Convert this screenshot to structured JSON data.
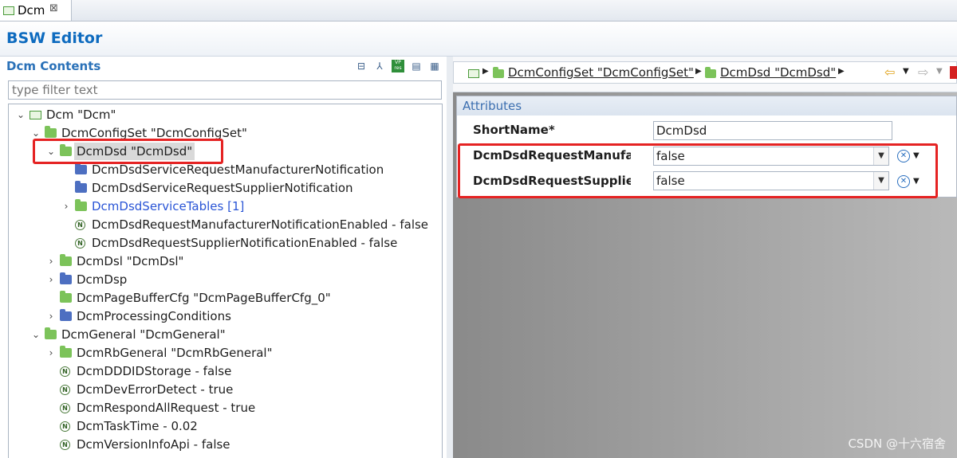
{
  "editor_tab": {
    "label": "Dcm",
    "close": "⊠"
  },
  "header": {
    "title": "BSW Editor"
  },
  "contents": {
    "title": "Dcm Contents",
    "filter_placeholder": "type filter text",
    "toolbar_vp_label": "VP res"
  },
  "tree": [
    {
      "text": "Dcm \"Dcm\"",
      "twisty": "⌄",
      "icon": "module"
    },
    {
      "text": "DcmConfigSet \"DcmConfigSet\"",
      "twisty": "⌄",
      "icon": "folder-green"
    },
    {
      "text": "DcmDsd \"DcmDsd\"",
      "twisty": "⌄",
      "icon": "folder-green",
      "selected": true
    },
    {
      "text": "DcmDsdServiceRequestManufacturerNotification",
      "twisty": "",
      "icon": "folder-blue"
    },
    {
      "text": "DcmDsdServiceRequestSupplierNotification",
      "twisty": "",
      "icon": "folder-blue"
    },
    {
      "text": "DcmDsdServiceTables [1]",
      "twisty": "›",
      "icon": "folder-green",
      "link": true
    },
    {
      "text": "DcmDsdRequestManufacturerNotificationEnabled - false",
      "twisty": "",
      "icon": "param"
    },
    {
      "text": "DcmDsdRequestSupplierNotificationEnabled - false",
      "twisty": "",
      "icon": "param"
    },
    {
      "text": "DcmDsl \"DcmDsl\"",
      "twisty": "›",
      "icon": "folder-green"
    },
    {
      "text": "DcmDsp",
      "twisty": "›",
      "icon": "folder-blue"
    },
    {
      "text": "DcmPageBufferCfg \"DcmPageBufferCfg_0\"",
      "twisty": "",
      "icon": "folder-green"
    },
    {
      "text": "DcmProcessingConditions",
      "twisty": "›",
      "icon": "folder-blue"
    },
    {
      "text": "DcmGeneral \"DcmGeneral\"",
      "twisty": "⌄",
      "icon": "folder-green"
    },
    {
      "text": "DcmRbGeneral \"DcmRbGeneral\"",
      "twisty": "›",
      "icon": "folder-green"
    },
    {
      "text": "DcmDDDIDStorage - false",
      "twisty": "",
      "icon": "param"
    },
    {
      "text": "DcmDevErrorDetect - true",
      "twisty": "",
      "icon": "param"
    },
    {
      "text": "DcmRespondAllRequest - true",
      "twisty": "",
      "icon": "param"
    },
    {
      "text": "DcmTaskTime - 0.02",
      "twisty": "",
      "icon": "param"
    },
    {
      "text": "DcmVersionInfoApi - false",
      "twisty": "",
      "icon": "param"
    }
  ],
  "breadcrumb": {
    "items": [
      "DcmConfigSet \"DcmConfigSet\"",
      "DcmDsd \"DcmDsd\""
    ]
  },
  "attributes": {
    "title": "Attributes",
    "short_name_label": "ShortName*",
    "short_name_value": "DcmDsd",
    "field1_label": "DcmDsdRequestManufact",
    "field1_value": "false",
    "field2_label": "DcmDsdRequestSupplie...l",
    "field2_value": "false"
  },
  "watermark": "CSDN @十六宿舍",
  "colors": {
    "accent": "#0e6bbf",
    "highlight": "#e52323",
    "folder_green": "#7cc35a",
    "folder_blue": "#4d6fc1"
  }
}
